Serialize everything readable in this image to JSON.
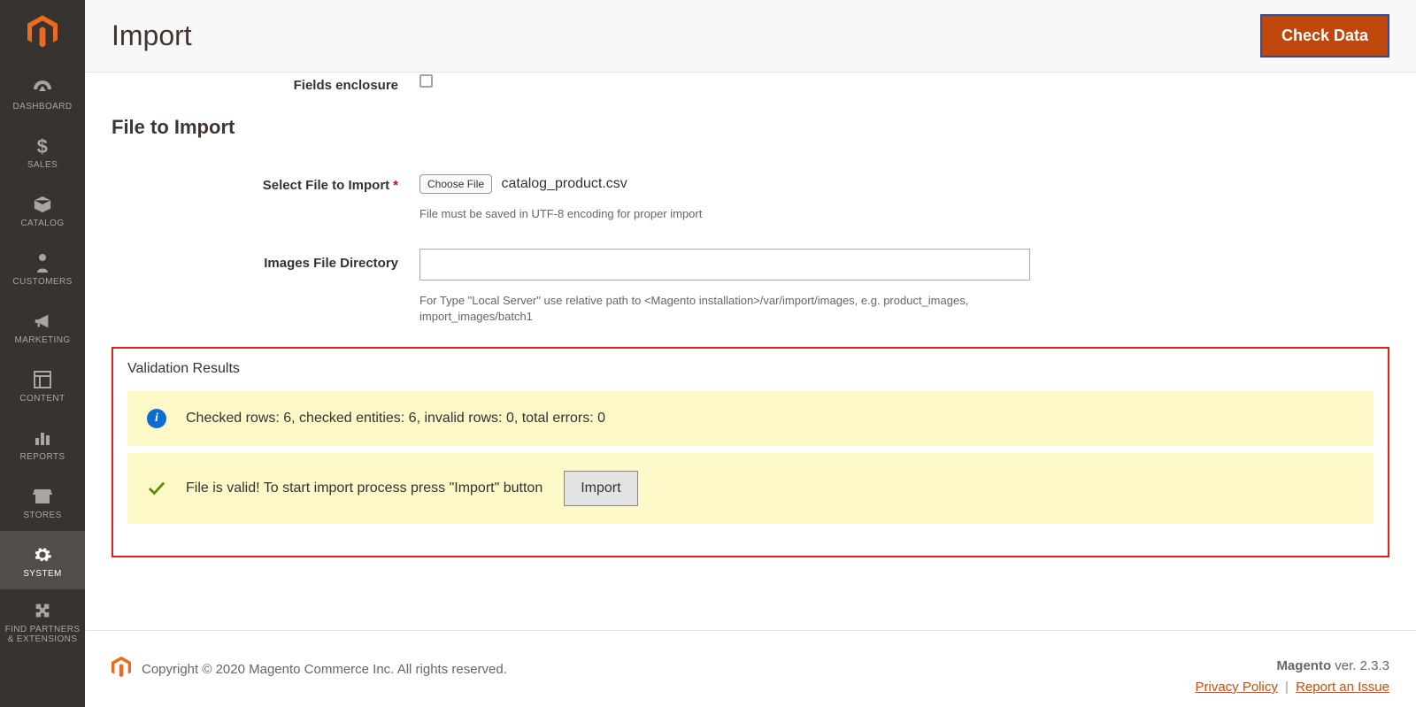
{
  "sidebar": {
    "items": [
      {
        "label": "DASHBOARD"
      },
      {
        "label": "SALES"
      },
      {
        "label": "CATALOG"
      },
      {
        "label": "CUSTOMERS"
      },
      {
        "label": "MARKETING"
      },
      {
        "label": "CONTENT"
      },
      {
        "label": "REPORTS"
      },
      {
        "label": "STORES"
      },
      {
        "label": "SYSTEM"
      },
      {
        "label": "FIND PARTNERS & EXTENSIONS"
      }
    ]
  },
  "header": {
    "title": "Import",
    "check_data_label": "Check Data"
  },
  "form": {
    "fields_enclosure_label": "Fields enclosure",
    "file_section_heading": "File to Import",
    "select_file_label": "Select File to Import",
    "choose_file_button": "Choose File",
    "selected_file_name": "catalog_product.csv",
    "file_note": "File must be saved in UTF-8 encoding for proper import",
    "images_dir_label": "Images File Directory",
    "images_dir_value": "",
    "images_dir_note": "For Type \"Local Server\" use relative path to <Magento installation>/var/import/images, e.g. product_images, import_images/batch1"
  },
  "validation": {
    "heading": "Validation Results",
    "info_msg": "Checked rows: 6, checked entities: 6, invalid rows: 0, total errors: 0",
    "success_msg": "File is valid! To start import process press \"Import\" button",
    "import_button": "Import"
  },
  "footer": {
    "copyright": "Copyright © 2020 Magento Commerce Inc. All rights reserved.",
    "product": "Magento",
    "version_prefix": " ver. ",
    "version": "2.3.3",
    "privacy": "Privacy Policy",
    "report": "Report an Issue"
  }
}
